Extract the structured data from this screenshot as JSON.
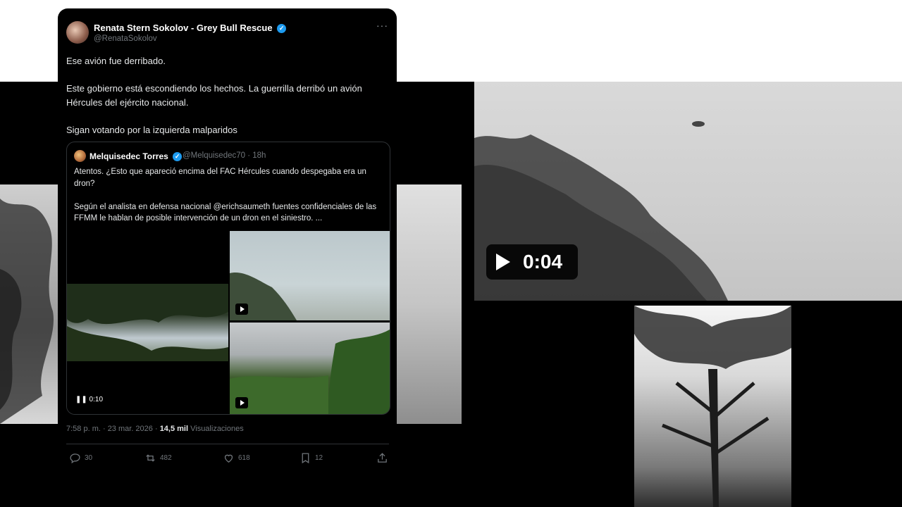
{
  "tweet": {
    "author_name": "Renata Stern Sokolov - Grey Bull Rescue",
    "handle": "@RenataSokolov",
    "more": "···",
    "paragraphs": [
      "Ese avión fue derribado.",
      "Este gobierno está escondiendo los hechos. La guerrilla derribó un avión Hércules del ejército nacional.",
      "Sigan votando por la izquierda malparidos"
    ],
    "timestamp": "7:58 p. m. · 23 mar. 2026 · ",
    "views_count": "14,5 mil",
    "views_label": "Visualizaciones",
    "actions": {
      "replies": "30",
      "reposts": "482",
      "likes": "618",
      "bookmarks": "12"
    }
  },
  "quote": {
    "author_name": "Melquisedec Torres",
    "meta": "@Melquisedec70 · 18h",
    "paragraphs": [
      "Atentos. ¿Esto que apareció encima del FAC Hércules cuando despegaba era un dron?",
      "Según el analista en defensa nacional @erichsaumeth fuentes confidenciales de las FFMM le hablan de posible intervención de un dron en el siniestro. ..."
    ],
    "video_time": "0:10"
  },
  "overlay": {
    "video_time": "0:04"
  },
  "colors": {
    "verified": "#1d9bf0",
    "background": "#000000",
    "muted_text": "#71767b"
  }
}
